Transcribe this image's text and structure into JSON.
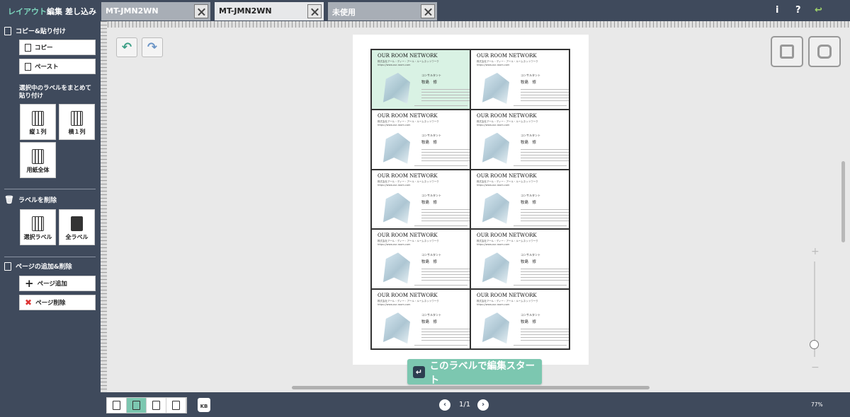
{
  "menu": {
    "layout": "レイアウト",
    "edit": "編集",
    "merge": "差し込み"
  },
  "tabs": [
    {
      "label": "MT-JMN2WN"
    },
    {
      "label": "MT-JMN2WN"
    },
    {
      "label": "未使用"
    }
  ],
  "top_icons": {
    "info": "i",
    "help": "?",
    "back": "↩"
  },
  "sidebar": {
    "copy_section": "コピー&貼り付け",
    "copy": "コピー",
    "paste": "ペースト",
    "bulk_title": "選択中のラベルをまとめて貼り付け",
    "col1": "縦１列",
    "row1": "横１列",
    "all_paper": "用紙全体",
    "delete_section": "ラベルを削除",
    "del_selected": "選択ラベル",
    "del_all": "全ラベル",
    "page_section": "ページの追加&削除",
    "add_page": "ページ追加",
    "del_page": "ページ削除"
  },
  "card": {
    "company": "OUR ROOM NETWORK",
    "company_sub": "株式会社アール・ディー・アール・ルームネットワーク",
    "url": "https://www.our-room.com",
    "role": "コンサルタント",
    "name": "牧島　修"
  },
  "start_button": "このラベルで編集スタート",
  "pager": {
    "prev": "‹",
    "next": "›",
    "page": "1/1"
  },
  "kb_label": "KB",
  "zoom": {
    "plus": "+",
    "minus": "−",
    "level": "77%"
  },
  "colors": {
    "accent": "#7cc7b0",
    "sidebar": "#3f4a5c",
    "selected_card": "#d9f2e4"
  }
}
